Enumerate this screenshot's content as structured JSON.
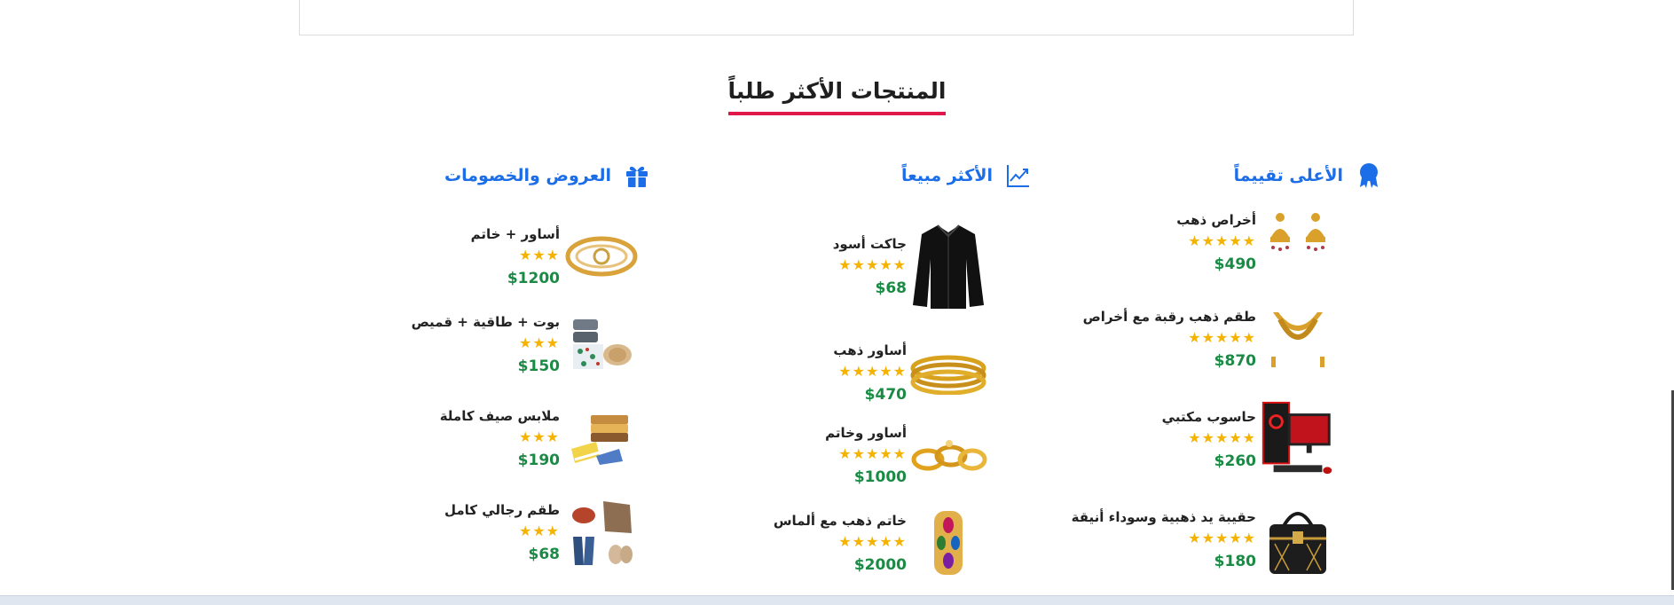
{
  "section": {
    "title": "المنتجات الأكثر طلباً"
  },
  "colors": {
    "accent": "#1c6ee8",
    "underline": "#e01747",
    "star": "#f5b301",
    "price": "#1a8a45"
  },
  "columns": [
    {
      "title": "الأعلى تقييماً",
      "icon": "award-badge-icon",
      "items": [
        {
          "name": "أخراص ذهب",
          "stars": "★★★★★",
          "price": "$490",
          "image": "gold-earrings"
        },
        {
          "name": "طقم ذهب رقبة مع أخراص",
          "stars": "★★★★★",
          "price": "$870",
          "image": "gold-necklace-set"
        },
        {
          "name": "حاسوب مكتبي",
          "stars": "★★★★★",
          "price": "$260",
          "image": "desktop-computer"
        },
        {
          "name": "حقيبة يد ذهبية وسوداء أنيقة",
          "stars": "★★★★★",
          "price": "$180",
          "image": "handbag"
        }
      ]
    },
    {
      "title": "الأكثر مبيعاً",
      "icon": "trending-up-icon",
      "items": [
        {
          "name": "جاكت أسود",
          "stars": "★★★★★",
          "price": "$68",
          "image": "black-jacket"
        },
        {
          "name": "أساور ذهب",
          "stars": "★★★★★",
          "price": "$470",
          "image": "gold-bangles"
        },
        {
          "name": "أساور وخاتم",
          "stars": "★★★★★",
          "price": "$1000",
          "image": "bracelets-and-ring"
        },
        {
          "name": "خاتم ذهب مع ألماس",
          "stars": "★★★★★",
          "price": "$2000",
          "image": "gold-diamond-ring"
        }
      ]
    },
    {
      "title": "العروض والخصومات",
      "icon": "gift-icon",
      "items": [
        {
          "name": "أساور + خاتم",
          "stars": "★★★",
          "price": "$1200",
          "image": "bracelet-ring-set"
        },
        {
          "name": "بوت + طاقية + قميص",
          "stars": "★★★",
          "price": "$150",
          "image": "boots-hat-shirt"
        },
        {
          "name": "ملابس صيف كاملة",
          "stars": "★★★",
          "price": "$190",
          "image": "summer-clothes"
        },
        {
          "name": "طقم رجالي كامل",
          "stars": "★★★",
          "price": "$68",
          "image": "mens-outfit"
        }
      ]
    }
  ]
}
